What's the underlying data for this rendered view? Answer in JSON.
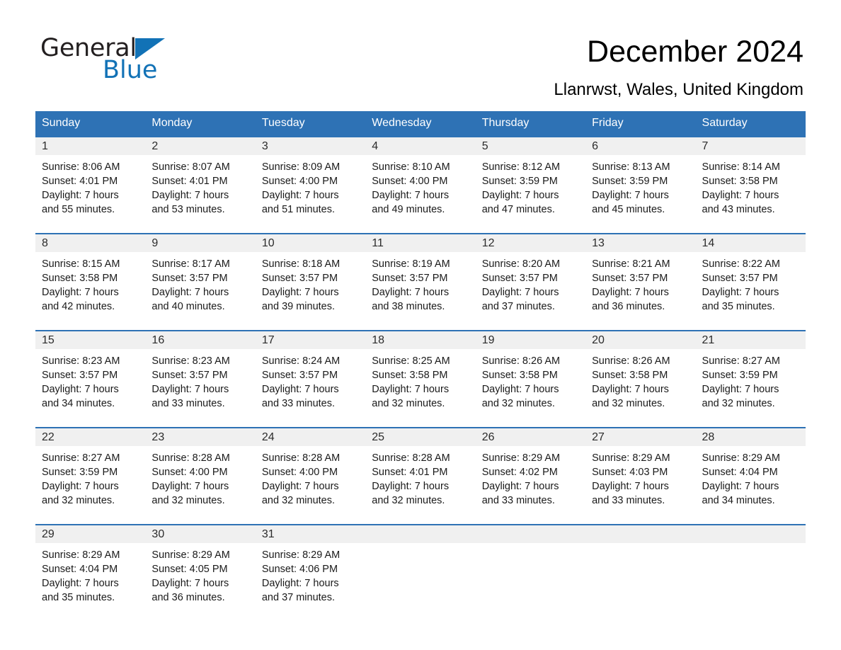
{
  "brand": {
    "name_part1": "General",
    "name_part2": "Blue",
    "triangle_color": "#1272b6",
    "text_color": "#231f20"
  },
  "header": {
    "month_title": "December 2024",
    "location": "Llanrwst, Wales, United Kingdom",
    "header_bg_color": "#2e72b5",
    "daynum_band_color": "#f0f0f0"
  },
  "weekday_headers": [
    "Sunday",
    "Monday",
    "Tuesday",
    "Wednesday",
    "Thursday",
    "Friday",
    "Saturday"
  ],
  "weeks": [
    {
      "days": [
        {
          "num": "1",
          "sunrise": "Sunrise: 8:06 AM",
          "sunset": "Sunset: 4:01 PM",
          "daylight_line1": "Daylight: 7 hours",
          "daylight_line2": "and 55 minutes."
        },
        {
          "num": "2",
          "sunrise": "Sunrise: 8:07 AM",
          "sunset": "Sunset: 4:01 PM",
          "daylight_line1": "Daylight: 7 hours",
          "daylight_line2": "and 53 minutes."
        },
        {
          "num": "3",
          "sunrise": "Sunrise: 8:09 AM",
          "sunset": "Sunset: 4:00 PM",
          "daylight_line1": "Daylight: 7 hours",
          "daylight_line2": "and 51 minutes."
        },
        {
          "num": "4",
          "sunrise": "Sunrise: 8:10 AM",
          "sunset": "Sunset: 4:00 PM",
          "daylight_line1": "Daylight: 7 hours",
          "daylight_line2": "and 49 minutes."
        },
        {
          "num": "5",
          "sunrise": "Sunrise: 8:12 AM",
          "sunset": "Sunset: 3:59 PM",
          "daylight_line1": "Daylight: 7 hours",
          "daylight_line2": "and 47 minutes."
        },
        {
          "num": "6",
          "sunrise": "Sunrise: 8:13 AM",
          "sunset": "Sunset: 3:59 PM",
          "daylight_line1": "Daylight: 7 hours",
          "daylight_line2": "and 45 minutes."
        },
        {
          "num": "7",
          "sunrise": "Sunrise: 8:14 AM",
          "sunset": "Sunset: 3:58 PM",
          "daylight_line1": "Daylight: 7 hours",
          "daylight_line2": "and 43 minutes."
        }
      ]
    },
    {
      "days": [
        {
          "num": "8",
          "sunrise": "Sunrise: 8:15 AM",
          "sunset": "Sunset: 3:58 PM",
          "daylight_line1": "Daylight: 7 hours",
          "daylight_line2": "and 42 minutes."
        },
        {
          "num": "9",
          "sunrise": "Sunrise: 8:17 AM",
          "sunset": "Sunset: 3:57 PM",
          "daylight_line1": "Daylight: 7 hours",
          "daylight_line2": "and 40 minutes."
        },
        {
          "num": "10",
          "sunrise": "Sunrise: 8:18 AM",
          "sunset": "Sunset: 3:57 PM",
          "daylight_line1": "Daylight: 7 hours",
          "daylight_line2": "and 39 minutes."
        },
        {
          "num": "11",
          "sunrise": "Sunrise: 8:19 AM",
          "sunset": "Sunset: 3:57 PM",
          "daylight_line1": "Daylight: 7 hours",
          "daylight_line2": "and 38 minutes."
        },
        {
          "num": "12",
          "sunrise": "Sunrise: 8:20 AM",
          "sunset": "Sunset: 3:57 PM",
          "daylight_line1": "Daylight: 7 hours",
          "daylight_line2": "and 37 minutes."
        },
        {
          "num": "13",
          "sunrise": "Sunrise: 8:21 AM",
          "sunset": "Sunset: 3:57 PM",
          "daylight_line1": "Daylight: 7 hours",
          "daylight_line2": "and 36 minutes."
        },
        {
          "num": "14",
          "sunrise": "Sunrise: 8:22 AM",
          "sunset": "Sunset: 3:57 PM",
          "daylight_line1": "Daylight: 7 hours",
          "daylight_line2": "and 35 minutes."
        }
      ]
    },
    {
      "days": [
        {
          "num": "15",
          "sunrise": "Sunrise: 8:23 AM",
          "sunset": "Sunset: 3:57 PM",
          "daylight_line1": "Daylight: 7 hours",
          "daylight_line2": "and 34 minutes."
        },
        {
          "num": "16",
          "sunrise": "Sunrise: 8:23 AM",
          "sunset": "Sunset: 3:57 PM",
          "daylight_line1": "Daylight: 7 hours",
          "daylight_line2": "and 33 minutes."
        },
        {
          "num": "17",
          "sunrise": "Sunrise: 8:24 AM",
          "sunset": "Sunset: 3:57 PM",
          "daylight_line1": "Daylight: 7 hours",
          "daylight_line2": "and 33 minutes."
        },
        {
          "num": "18",
          "sunrise": "Sunrise: 8:25 AM",
          "sunset": "Sunset: 3:58 PM",
          "daylight_line1": "Daylight: 7 hours",
          "daylight_line2": "and 32 minutes."
        },
        {
          "num": "19",
          "sunrise": "Sunrise: 8:26 AM",
          "sunset": "Sunset: 3:58 PM",
          "daylight_line1": "Daylight: 7 hours",
          "daylight_line2": "and 32 minutes."
        },
        {
          "num": "20",
          "sunrise": "Sunrise: 8:26 AM",
          "sunset": "Sunset: 3:58 PM",
          "daylight_line1": "Daylight: 7 hours",
          "daylight_line2": "and 32 minutes."
        },
        {
          "num": "21",
          "sunrise": "Sunrise: 8:27 AM",
          "sunset": "Sunset: 3:59 PM",
          "daylight_line1": "Daylight: 7 hours",
          "daylight_line2": "and 32 minutes."
        }
      ]
    },
    {
      "days": [
        {
          "num": "22",
          "sunrise": "Sunrise: 8:27 AM",
          "sunset": "Sunset: 3:59 PM",
          "daylight_line1": "Daylight: 7 hours",
          "daylight_line2": "and 32 minutes."
        },
        {
          "num": "23",
          "sunrise": "Sunrise: 8:28 AM",
          "sunset": "Sunset: 4:00 PM",
          "daylight_line1": "Daylight: 7 hours",
          "daylight_line2": "and 32 minutes."
        },
        {
          "num": "24",
          "sunrise": "Sunrise: 8:28 AM",
          "sunset": "Sunset: 4:00 PM",
          "daylight_line1": "Daylight: 7 hours",
          "daylight_line2": "and 32 minutes."
        },
        {
          "num": "25",
          "sunrise": "Sunrise: 8:28 AM",
          "sunset": "Sunset: 4:01 PM",
          "daylight_line1": "Daylight: 7 hours",
          "daylight_line2": "and 32 minutes."
        },
        {
          "num": "26",
          "sunrise": "Sunrise: 8:29 AM",
          "sunset": "Sunset: 4:02 PM",
          "daylight_line1": "Daylight: 7 hours",
          "daylight_line2": "and 33 minutes."
        },
        {
          "num": "27",
          "sunrise": "Sunrise: 8:29 AM",
          "sunset": "Sunset: 4:03 PM",
          "daylight_line1": "Daylight: 7 hours",
          "daylight_line2": "and 33 minutes."
        },
        {
          "num": "28",
          "sunrise": "Sunrise: 8:29 AM",
          "sunset": "Sunset: 4:04 PM",
          "daylight_line1": "Daylight: 7 hours",
          "daylight_line2": "and 34 minutes."
        }
      ]
    },
    {
      "days": [
        {
          "num": "29",
          "sunrise": "Sunrise: 8:29 AM",
          "sunset": "Sunset: 4:04 PM",
          "daylight_line1": "Daylight: 7 hours",
          "daylight_line2": "and 35 minutes."
        },
        {
          "num": "30",
          "sunrise": "Sunrise: 8:29 AM",
          "sunset": "Sunset: 4:05 PM",
          "daylight_line1": "Daylight: 7 hours",
          "daylight_line2": "and 36 minutes."
        },
        {
          "num": "31",
          "sunrise": "Sunrise: 8:29 AM",
          "sunset": "Sunset: 4:06 PM",
          "daylight_line1": "Daylight: 7 hours",
          "daylight_line2": "and 37 minutes."
        },
        {
          "num": "",
          "sunrise": "",
          "sunset": "",
          "daylight_line1": "",
          "daylight_line2": ""
        },
        {
          "num": "",
          "sunrise": "",
          "sunset": "",
          "daylight_line1": "",
          "daylight_line2": ""
        },
        {
          "num": "",
          "sunrise": "",
          "sunset": "",
          "daylight_line1": "",
          "daylight_line2": ""
        },
        {
          "num": "",
          "sunrise": "",
          "sunset": "",
          "daylight_line1": "",
          "daylight_line2": ""
        }
      ]
    }
  ]
}
